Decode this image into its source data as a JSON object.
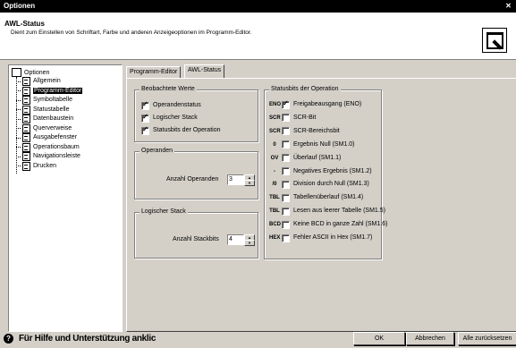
{
  "window": {
    "title": "Optionen",
    "close": "✕"
  },
  "header": {
    "title": "AWL-Status",
    "description": "Dient zum Einstellen von Schriftart, Farbe und anderen Anzeigeoptionen im Programm-Editor."
  },
  "tree": {
    "root": "Optionen",
    "items": [
      "Allgemein",
      "Programm-Editor",
      "Symboltabelle",
      "Statustabelle",
      "Datenbaustein",
      "Querverweise",
      "Ausgabefenster",
      "Operationsbaum",
      "Navigationsleiste",
      "Drucken"
    ]
  },
  "tabs": [
    "Programm-Editor",
    "AWL-Status"
  ],
  "observed": {
    "title": "Beobachtete Werte",
    "items": [
      {
        "label": "Operandenstatus",
        "checked": true
      },
      {
        "label": "Logischer Stack",
        "checked": true
      },
      {
        "label": "Statusbits der Operation",
        "checked": true
      }
    ]
  },
  "operands": {
    "title": "Operanden",
    "label": "Anzahl Operanden",
    "value": "3"
  },
  "stack": {
    "title": "Logischer Stack",
    "label": "Anzahl Stackbits",
    "value": "4"
  },
  "statusbits": {
    "title": "Statusbits der Operation",
    "items": [
      {
        "icon": "ENO",
        "label": "Freigabeausgang (ENO)",
        "checked": true
      },
      {
        "icon": "SCR",
        "label": "SCR-Bit",
        "checked": false
      },
      {
        "icon": "SCR",
        "label": "SCR-Bereichsbit",
        "checked": false
      },
      {
        "icon": "0",
        "label": "Ergebnis Null (SM1.0)",
        "checked": false
      },
      {
        "icon": "OV",
        "label": "Überlauf (SM1.1)",
        "checked": false
      },
      {
        "icon": "-",
        "label": "Negatives Ergebnis (SM1.2)",
        "checked": false
      },
      {
        "icon": "/0",
        "label": "Division durch Null (SM1.3)",
        "checked": false
      },
      {
        "icon": "TBL",
        "label": "Tabellenüberlauf (SM1.4)",
        "checked": false
      },
      {
        "icon": "TBL",
        "label": "Lesen aus leerer Tabelle (SM1.5)",
        "checked": false
      },
      {
        "icon": "BCD",
        "label": "Keine BCD in ganze Zahl (SM1.6)",
        "checked": false
      },
      {
        "icon": "HEX",
        "label": "Fehler ASCII in Hex (SM1.7)",
        "checked": false
      }
    ]
  },
  "footer": {
    "help": "Für Hilfe und Unterstützung anklic",
    "ok": "OK",
    "cancel": "Abbrechen",
    "reset": "Alle zurücksetzen"
  }
}
